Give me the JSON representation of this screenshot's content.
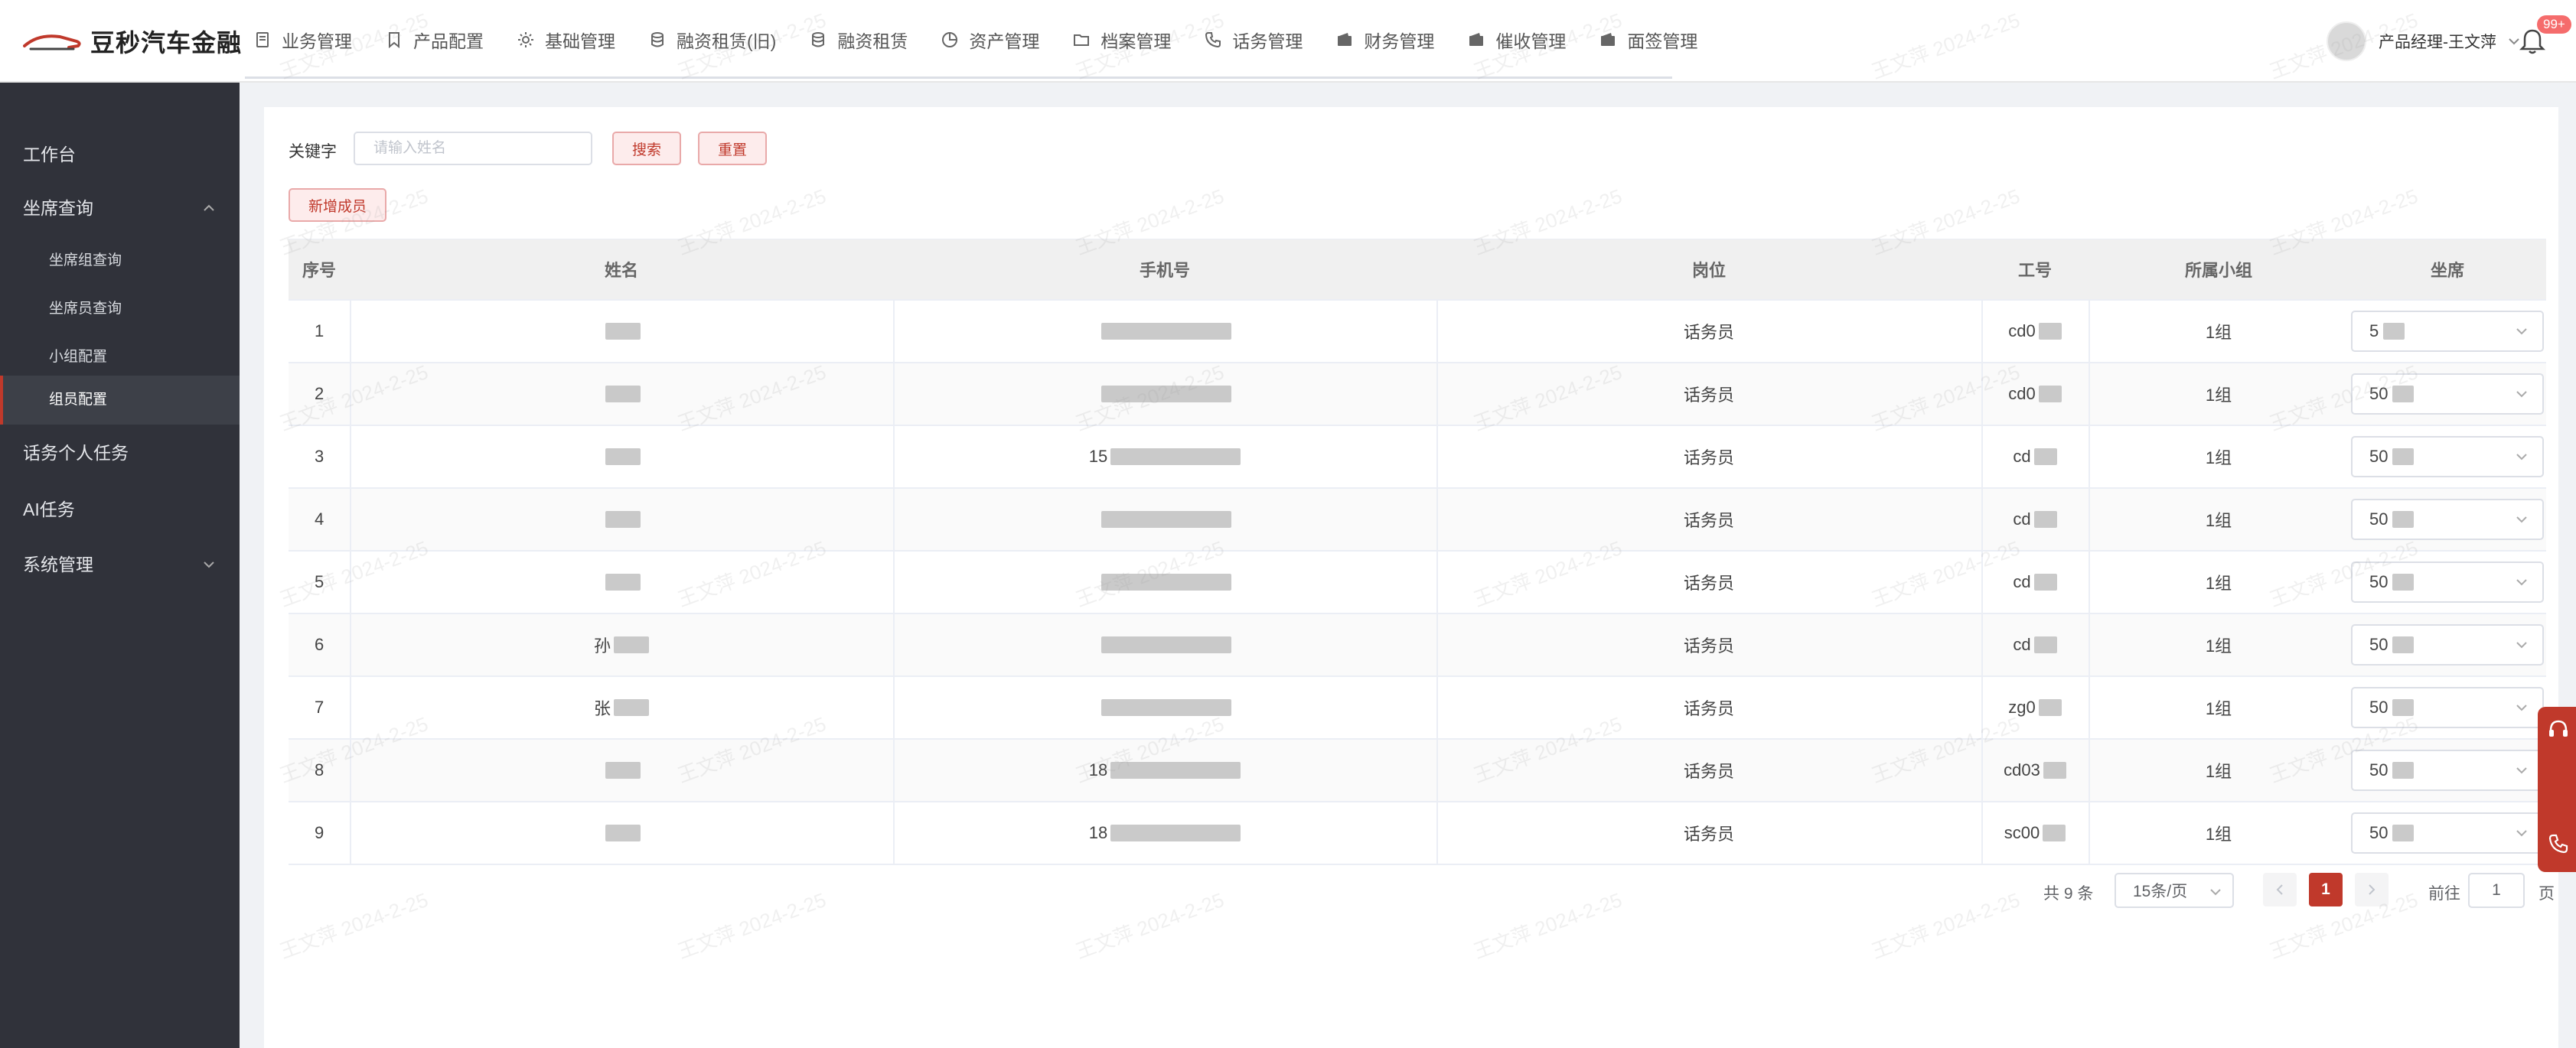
{
  "header": {
    "logo_text": "豆秒汽车金融",
    "nav": [
      {
        "label": "业务管理",
        "icon": "document-icon"
      },
      {
        "label": "产品配置",
        "icon": "bookmark-icon"
      },
      {
        "label": "基础管理",
        "icon": "gear-icon"
      },
      {
        "label": "融资租赁(旧)",
        "icon": "database-icon"
      },
      {
        "label": "融资租赁",
        "icon": "database-icon"
      },
      {
        "label": "资产管理",
        "icon": "pie-chart-icon"
      },
      {
        "label": "档案管理",
        "icon": "folder-icon"
      },
      {
        "label": "话务管理",
        "icon": "phone-icon"
      },
      {
        "label": "财务管理",
        "icon": "wallet-icon"
      },
      {
        "label": "催收管理",
        "icon": "wallet-icon"
      },
      {
        "label": "面签管理",
        "icon": "wallet-icon"
      }
    ],
    "user_name": "产品经理-王文萍",
    "notification_count": "99+"
  },
  "sidebar": {
    "items": [
      {
        "label": "工作台",
        "level": "top"
      },
      {
        "label": "坐席查询",
        "level": "top",
        "expanded": true
      },
      {
        "label": "坐席组查询",
        "level": "sub"
      },
      {
        "label": "坐席员查询",
        "level": "sub"
      },
      {
        "label": "小组配置",
        "level": "sub"
      },
      {
        "label": "组员配置",
        "level": "sub",
        "active": true
      },
      {
        "label": "话务个人任务",
        "level": "top"
      },
      {
        "label": "AI任务",
        "level": "top"
      },
      {
        "label": "系统管理",
        "level": "top",
        "expanded": false
      }
    ]
  },
  "search": {
    "label": "关键字",
    "placeholder": "请输入姓名",
    "search_label": "搜索",
    "reset_label": "重置",
    "add_label": "新增成员"
  },
  "table": {
    "columns": [
      "序号",
      "姓名",
      "手机号",
      "岗位",
      "工号",
      "所属小组",
      "坐席"
    ],
    "rows": [
      {
        "no": "1",
        "name": "",
        "phone": "",
        "post": "话务员",
        "emp_id": "cd0",
        "group": "1组",
        "seat": "5"
      },
      {
        "no": "2",
        "name": "",
        "phone": "",
        "post": "话务员",
        "emp_id": "cd0",
        "group": "1组",
        "seat": "50"
      },
      {
        "no": "3",
        "name": "",
        "phone": "15",
        "post": "话务员",
        "emp_id": "cd",
        "group": "1组",
        "seat": "50"
      },
      {
        "no": "4",
        "name": "",
        "phone": "",
        "post": "话务员",
        "emp_id": "cd",
        "group": "1组",
        "seat": "50"
      },
      {
        "no": "5",
        "name": "",
        "phone": "",
        "post": "话务员",
        "emp_id": "cd",
        "group": "1组",
        "seat": "50"
      },
      {
        "no": "6",
        "name": "孙",
        "phone": "",
        "post": "话务员",
        "emp_id": "cd",
        "group": "1组",
        "seat": "50"
      },
      {
        "no": "7",
        "name": "张",
        "phone": "",
        "post": "话务员",
        "emp_id": "zg0",
        "group": "1组",
        "seat": "50"
      },
      {
        "no": "8",
        "name": "",
        "phone": "18",
        "post": "话务员",
        "emp_id": "cd03",
        "group": "1组",
        "seat": "50"
      },
      {
        "no": "9",
        "name": "",
        "phone": "18",
        "post": "话务员",
        "emp_id": "sc00",
        "group": "1组",
        "seat": "50"
      }
    ]
  },
  "pagination": {
    "total": "共 9 条",
    "page_size": "15条/页",
    "current_page": "1",
    "goto_label": "前往",
    "goto_value": "1",
    "page_label": "页"
  },
  "watermark": "王文萍 2024-2-25",
  "colors": {
    "accent": "#c0392b",
    "sidebar_bg": "#30323a"
  }
}
